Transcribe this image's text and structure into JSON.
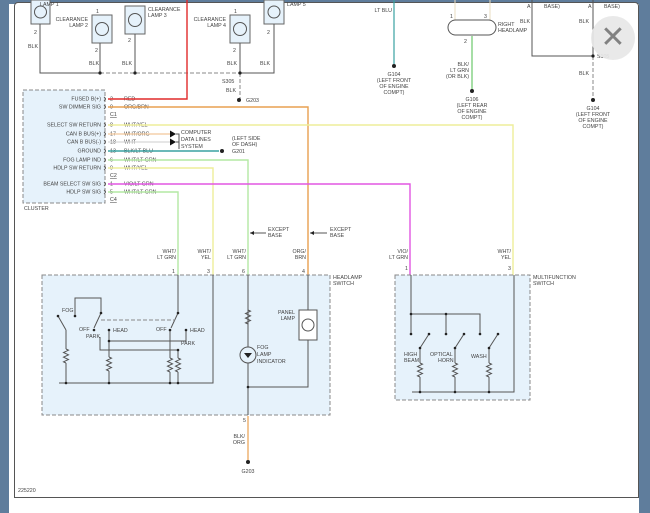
{
  "window": {
    "close_icon": "close-icon"
  },
  "diagram_id": "225220",
  "colors": {
    "red": "#e02a2a",
    "org_brn": "#e8a050",
    "wht_yel": "#eeee9a",
    "wht_lt_grn": "#b4e8a4",
    "blk_lt_blu": "#3aa2a2",
    "vio_lt_grn": "#e256e2",
    "can": "#f2c89a",
    "blk_lt_grn": "#6cc86c",
    "switch_fill": "#e6f2fb"
  },
  "top_lamps": {
    "lamp1": "LAMP 1",
    "lamp2": [
      "CLEARANCE",
      "LAMP 2"
    ],
    "lamp3": [
      "CLEARANCE",
      "LAMP 3"
    ],
    "lamp4": [
      "CLEARANCE",
      "LAMP 4"
    ],
    "lamp5": "LAMP 5",
    "pin1": "1",
    "pin2": "2",
    "wire": "BLK",
    "splice": "S305",
    "ground": "G203"
  },
  "right_top": {
    "lt_blu_wire": "LT BLU",
    "g104_left": [
      "G104",
      "(LEFT FRONT",
      "OF ENGINE",
      "COMPT)"
    ],
    "headlamp": [
      "RIGHT",
      "HEADLAMP"
    ],
    "pin1": "1",
    "pin2": "2",
    "pin3": "3",
    "headlamp_wire": [
      "BLK/",
      "LT GRN",
      "(OR BLK)"
    ],
    "g106": [
      "G106",
      "(LEFT REAR",
      "OF ENGINE",
      "COMPT)"
    ],
    "base": "BASE)",
    "a": "A",
    "blk": "BLK",
    "splice": "S105",
    "g104_right": [
      "G104",
      "(LEFT FRONT",
      "OF ENGINE",
      "COMPT)"
    ]
  },
  "cluster": {
    "label": "CLUSTER",
    "connectors": {
      "c1": "C1",
      "c2": "C2",
      "c4": "C4"
    },
    "pins": [
      {
        "label": "FUSED B(+)",
        "pin": "2",
        "wire": "RED"
      },
      {
        "label": "SW DIMMER SIG",
        "pin": "9",
        "wire": "ORG/BRN"
      },
      {
        "label": "SELECT SW RETURN",
        "pin": "8",
        "wire": "WHT/YEL"
      },
      {
        "label": "CAN B BUS(+)",
        "pin": "17",
        "wire": "WHT/ORG"
      },
      {
        "label": "CAN B BUS(-)",
        "pin": "18",
        "wire": "WHT"
      },
      {
        "label": "GROUND",
        "pin": "13",
        "wire": "BLK/LT BLU"
      },
      {
        "label": "FOG LAMP IND",
        "pin": "6",
        "wire": "WHT/LT GRN"
      },
      {
        "label": "HDLP SW RETURN",
        "pin": "9",
        "wire": "WHT/YEL"
      },
      {
        "label": "BEAM SELECT SW SIG",
        "pin": "1",
        "wire": "VIO/LT GRN"
      },
      {
        "label": "HDLP SW SIG",
        "pin": "5",
        "wire": "WHT/LT GRN"
      }
    ],
    "data_lines": [
      "COMPUTER",
      "DATA LINES",
      "SYSTEM"
    ],
    "g201": [
      "(LEFT SIDE",
      "OF DASH)",
      "G201"
    ]
  },
  "except_base": [
    "EXCEPT",
    "BASE"
  ],
  "headlamp_switch": {
    "label": [
      "HEADLAMP",
      "SWITCH"
    ],
    "wires": [
      {
        "pin": "1",
        "wire": [
          "WHT/",
          "LT GRN"
        ]
      },
      {
        "pin": "3",
        "wire": [
          "WHT/",
          "YEL"
        ]
      },
      {
        "pin": "6",
        "wire": [
          "WHT/",
          "LT GRN"
        ]
      },
      {
        "pin": "4",
        "wire": [
          "ORG/",
          "BRN"
        ]
      }
    ],
    "fog": "FOG",
    "off": "OFF",
    "park": "PARK",
    "head": "HEAD",
    "panel_lamp": [
      "PANEL",
      "LAMP"
    ],
    "fog_indicator": [
      "FOG",
      "LAMP",
      "INDICATOR"
    ],
    "bottom_pin": "5",
    "bottom_wire": [
      "BLK/",
      "ORG"
    ],
    "ground": "G203"
  },
  "multifunction_switch": {
    "label": [
      "MULTIFUNCTION",
      "SWITCH"
    ],
    "wires": [
      {
        "pin": "1",
        "wire": [
          "VIO/",
          "LT GRN"
        ]
      },
      {
        "pin": "3",
        "wire": [
          "WHT/",
          "YEL"
        ]
      }
    ],
    "high_beam": [
      "HIGH",
      "BEAM"
    ],
    "optical_horn": [
      "OPTICAL",
      "HORN"
    ],
    "wash": "WASH"
  }
}
